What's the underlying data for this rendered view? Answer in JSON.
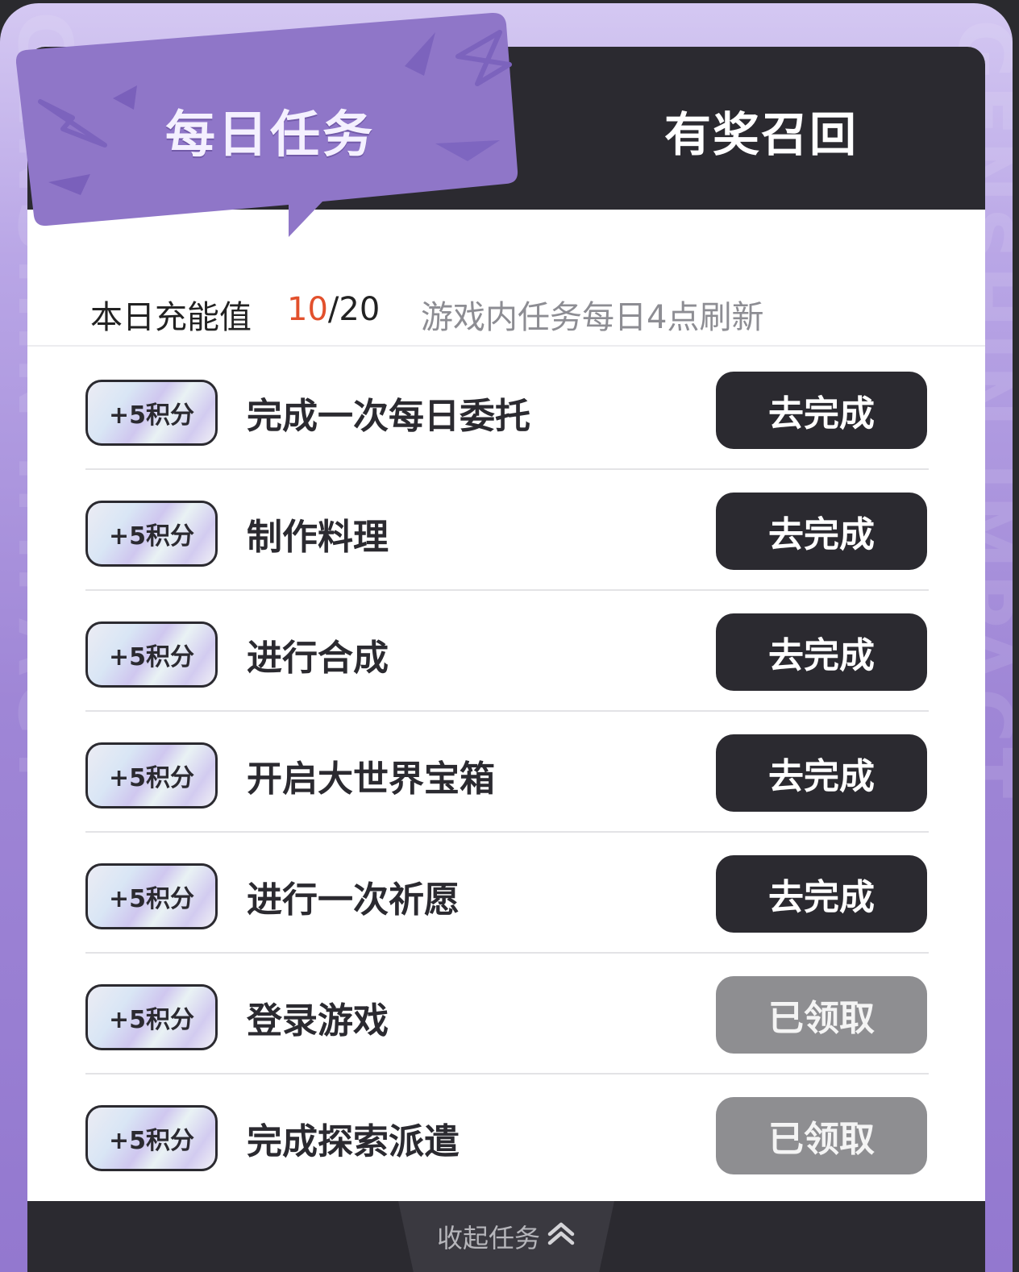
{
  "tabs": {
    "daily": "每日任务",
    "recall": "有奖召回"
  },
  "energy": {
    "label": "本日充能值",
    "current": "10",
    "separator": "/",
    "max": "20",
    "refresh_note": "游戏内任务每日4点刷新"
  },
  "tasks": [
    {
      "reward": "+5积分",
      "name": "完成一次每日委托",
      "action": "去完成",
      "status": "pending"
    },
    {
      "reward": "+5积分",
      "name": "制作料理",
      "action": "去完成",
      "status": "pending"
    },
    {
      "reward": "+5积分",
      "name": "进行合成",
      "action": "去完成",
      "status": "pending"
    },
    {
      "reward": "+5积分",
      "name": "开启大世界宝箱",
      "action": "去完成",
      "status": "pending"
    },
    {
      "reward": "+5积分",
      "name": "进行一次祈愿",
      "action": "去完成",
      "status": "pending"
    },
    {
      "reward": "+5积分",
      "name": "登录游戏",
      "action": "已领取",
      "status": "claimed"
    },
    {
      "reward": "+5积分",
      "name": "完成探索派遣",
      "action": "已领取",
      "status": "claimed"
    }
  ],
  "footer": {
    "collapse_label": "收起任务",
    "collapse_icon": "double-chevron-up-icon"
  },
  "colors": {
    "accent_purple": "#8f76c8",
    "dark": "#2b2a30",
    "highlight_orange": "#e2502c",
    "claimed_gray": "#8e8e91"
  }
}
